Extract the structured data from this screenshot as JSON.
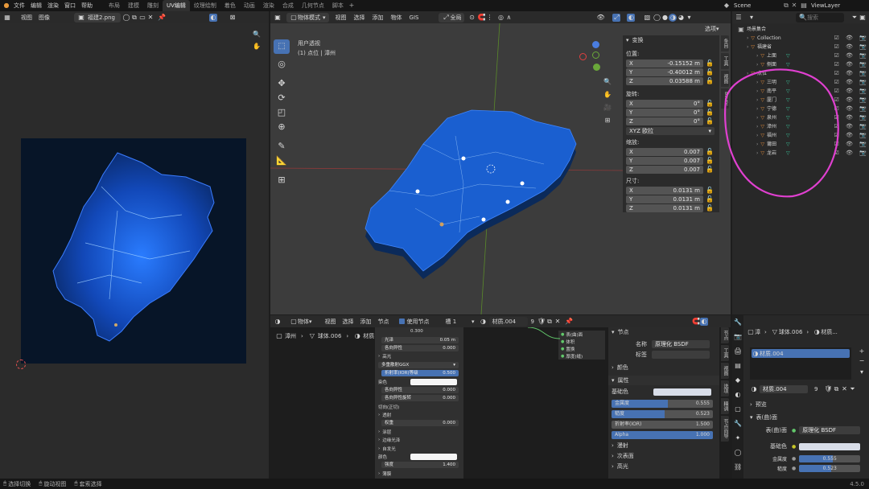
{
  "menu": [
    "文件",
    "编辑",
    "渲染",
    "窗口",
    "帮助"
  ],
  "workspaces": [
    "布局",
    "建模",
    "雕刻",
    "UV编辑",
    "纹理绘制",
    "着色",
    "动画",
    "渲染",
    "合成",
    "几何节点",
    "脚本"
  ],
  "active_workspace": "UV编辑",
  "scene": "Scene",
  "viewlayer": "ViewLayer",
  "uv_editor": {
    "menu": [
      "视图",
      "图像"
    ],
    "image_name": "福建2.png"
  },
  "viewport": {
    "mode": "物体模式",
    "menu": [
      "视图",
      "选择",
      "添加",
      "物体",
      "GIS"
    ],
    "orientation": "全局",
    "overlay_label": "选项",
    "view_title": "用户透视",
    "view_subtitle": "(1) 点位 | 漳州",
    "tabs": [
      "条目",
      "工具",
      "视图",
      "Bsurv"
    ]
  },
  "transform": {
    "title": "变换",
    "location_label": "位置:",
    "location": [
      {
        "axis": "X",
        "value": "-0.15152 m"
      },
      {
        "axis": "Y",
        "value": "-0.40012 m"
      },
      {
        "axis": "Z",
        "value": "0.03588 m"
      }
    ],
    "rotation_label": "旋转:",
    "rotation": [
      {
        "axis": "X",
        "value": "0°"
      },
      {
        "axis": "Y",
        "value": "0°"
      },
      {
        "axis": "Z",
        "value": "0°"
      }
    ],
    "rotation_mode": "XYZ 欧拉",
    "scale_label": "缩放:",
    "scale": [
      {
        "axis": "X",
        "value": "0.007"
      },
      {
        "axis": "Y",
        "value": "0.007"
      },
      {
        "axis": "Z",
        "value": "0.007"
      }
    ],
    "dims_label": "尺寸:",
    "dims": [
      {
        "axis": "X",
        "value": "0.0131 m"
      },
      {
        "axis": "Y",
        "value": "0.0131 m"
      },
      {
        "axis": "Z",
        "value": "0.0131 m"
      }
    ]
  },
  "outliner": {
    "search_placeholder": "搜索",
    "root": "场景集合",
    "items": [
      {
        "name": "Collection",
        "indent": 1
      },
      {
        "name": "福建省",
        "indent": 1
      },
      {
        "name": "上面",
        "indent": 2
      },
      {
        "name": "侧面",
        "indent": 2
      },
      {
        "name": "点位",
        "indent": 1
      },
      {
        "name": "三明",
        "indent": 2
      },
      {
        "name": "南平",
        "indent": 2
      },
      {
        "name": "厦门",
        "indent": 2
      },
      {
        "name": "宁德",
        "indent": 2
      },
      {
        "name": "泉州",
        "indent": 2
      },
      {
        "name": "漳州",
        "indent": 2
      },
      {
        "name": "福州",
        "indent": 2
      },
      {
        "name": "莆田",
        "indent": 2
      },
      {
        "name": "龙岩",
        "indent": 2
      }
    ]
  },
  "node_editor": {
    "mode": "物体",
    "menu": [
      "视图",
      "选择",
      "添加",
      "节点"
    ],
    "use_nodes": "使用节点",
    "slot": "槽 1",
    "material": "材质.004",
    "users": "9",
    "breadcrumb": [
      "漳州",
      "球体.006",
      "材质.004"
    ],
    "node_rows": [
      {
        "label": "0.300",
        "type": "value"
      },
      {
        "label": "光泽",
        "value": "0.05 m",
        "type": "field"
      },
      {
        "label": "各向异性",
        "value": "0.000",
        "type": "field"
      },
      {
        "label": "高光",
        "type": "section"
      },
      {
        "label": "多重散射GGX",
        "type": "dropdown"
      },
      {
        "label": "折射率(IOR)等级",
        "value": "0.500",
        "type": "blue"
      },
      {
        "label": "染色",
        "type": "color"
      },
      {
        "label": "各向异性",
        "value": "0.000",
        "type": "field"
      },
      {
        "label": "各向异性旋转",
        "value": "0.000",
        "type": "field"
      },
      {
        "label": "切向(正切)",
        "type": "text"
      },
      {
        "label": "透射",
        "type": "section"
      },
      {
        "label": "权重",
        "value": "0.000",
        "type": "field"
      },
      {
        "label": "涂层",
        "type": "section"
      },
      {
        "label": "边缘光泽",
        "type": "section"
      },
      {
        "label": "自发光",
        "type": "section"
      },
      {
        "label": "颜色",
        "type": "color"
      },
      {
        "label": "强度",
        "value": "1.400",
        "type": "field"
      },
      {
        "label": "薄膜",
        "type": "section"
      }
    ],
    "sockets": [
      "表(曲)面",
      "体积",
      "置换",
      "厚度(缝)"
    ]
  },
  "node_panel": {
    "title": "节点",
    "name_label": "名称",
    "name_value": "原理化 BSDF",
    "label_label": "标签",
    "color_label": "颜色",
    "props_title": "属性",
    "base_color": "基础色",
    "fields": [
      {
        "label": "金属度",
        "value": "0.555",
        "fill": 0.555
      },
      {
        "label": "糙度",
        "value": "0.523",
        "fill": 0.523
      },
      {
        "label": "折射率(IOR)",
        "value": "1.500",
        "fill": 0
      },
      {
        "label": "Alpha",
        "value": "1.000",
        "fill": 1
      }
    ],
    "sections": [
      "漫射",
      "次表面",
      "高光"
    ],
    "tabs": [
      "节点",
      "工具",
      "视图",
      "选项",
      "精调",
      "节点向导"
    ]
  },
  "properties": {
    "breadcrumb": [
      "漳",
      "球体.006",
      "材质..."
    ],
    "material_slot": "材质.004",
    "material_name": "材质.004",
    "users": "9",
    "preview": "预览",
    "surface": "表(曲)面",
    "surface_label": "表(曲)面",
    "surface_value": "原理化 BSDF",
    "base_color": "基础色",
    "fields": [
      {
        "label": "金属度",
        "value": "0.555",
        "fill": 0.555
      },
      {
        "label": "糙度",
        "value": "0.523",
        "fill": 0.523
      }
    ]
  },
  "status": {
    "items": [
      "选择切换",
      "旋动视图",
      "套索选择"
    ],
    "version": "4.5.0"
  },
  "colors": {
    "accent": "#4772b3",
    "orange": "#e08b3b",
    "annotation": "#e040d0"
  }
}
